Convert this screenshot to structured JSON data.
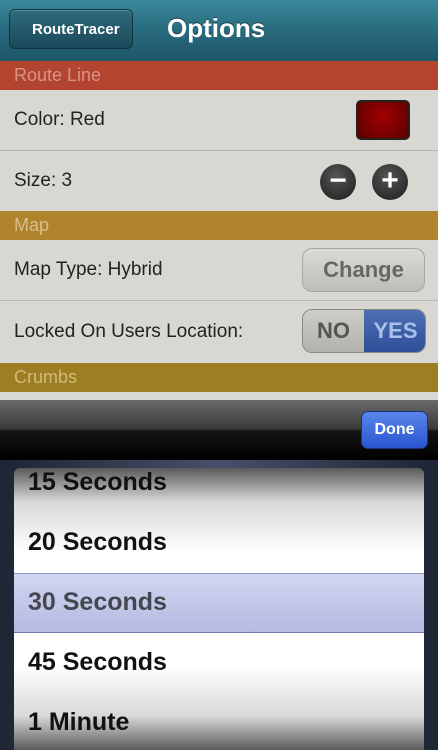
{
  "navbar": {
    "back_label": "RouteTracer",
    "title": "Options"
  },
  "sections": {
    "route_line": {
      "header": "Route Line",
      "color_label": "Color: Red",
      "color_value": "#8b0000",
      "size_label": "Size: 3",
      "minus_symbol": "−",
      "plus_symbol": "+"
    },
    "map": {
      "header": "Map",
      "map_type_label": "Map Type: Hybrid",
      "change_label": "Change",
      "locked_label": "Locked On Users Location:",
      "toggle_no": "NO",
      "toggle_yes": "YES",
      "locked_value": "YES"
    },
    "crumbs": {
      "header": "Crumbs"
    }
  },
  "picker": {
    "done_label": "Done",
    "options": [
      "15 Seconds",
      "20 Seconds",
      "30 Seconds",
      "45 Seconds",
      "1 Minute"
    ],
    "selected": "30 Seconds"
  }
}
